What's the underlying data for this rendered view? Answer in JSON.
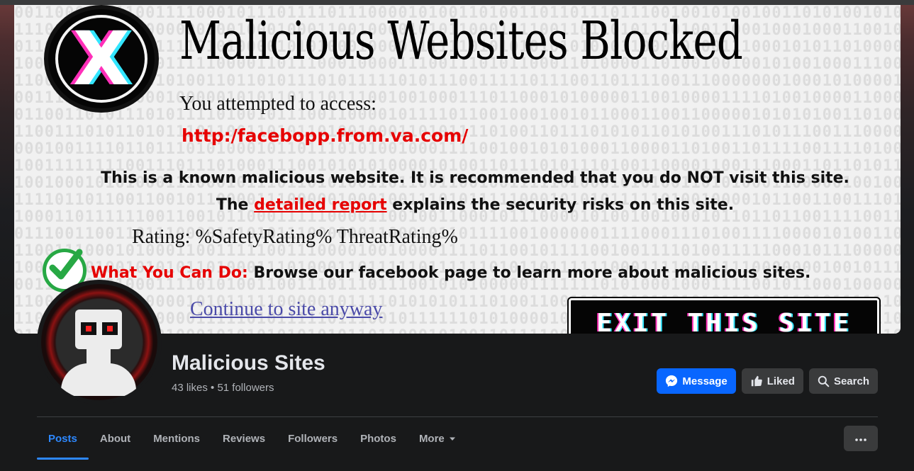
{
  "cover": {
    "headline": "Malicious Websites Blocked",
    "attempted": "You attempted to access:",
    "url": "http:/facebopp.from.va.com/",
    "known_text": "This is a known malicious website. It is recommended that you do NOT visit this site. The",
    "report_link": "detailed report",
    "report_tail": "explains the security risks on this site.",
    "rating": "Rating: %SafetyRating% ThreatRating%",
    "what_label": "What You Can Do:",
    "what_text": "Browse our facebook page to learn more about malicious sites.",
    "continue_link": "Continue to site anyway",
    "exit_button": "EXIT THIS SITE",
    "badge_glyph": "X",
    "background_pattern": "binary-digits"
  },
  "page": {
    "name": "Malicious Sites",
    "stats": "43 likes • 51 followers"
  },
  "actions": {
    "message": "Message",
    "liked": "Liked",
    "search": "Search"
  },
  "tabs": [
    {
      "label": "Posts",
      "active": true
    },
    {
      "label": "About"
    },
    {
      "label": "Mentions"
    },
    {
      "label": "Reviews"
    },
    {
      "label": "Followers"
    },
    {
      "label": "Photos"
    },
    {
      "label": "More"
    }
  ],
  "icons": {
    "message": "messenger-icon",
    "liked": "thumbs-up-icon",
    "search": "search-icon",
    "more": "chevron-down-icon",
    "overflow": "more-horizontal-icon"
  },
  "colors": {
    "accent": "#0866ff",
    "active_tab": "#2d88ff",
    "alert_red": "#e60000",
    "check_green": "#27a844"
  }
}
